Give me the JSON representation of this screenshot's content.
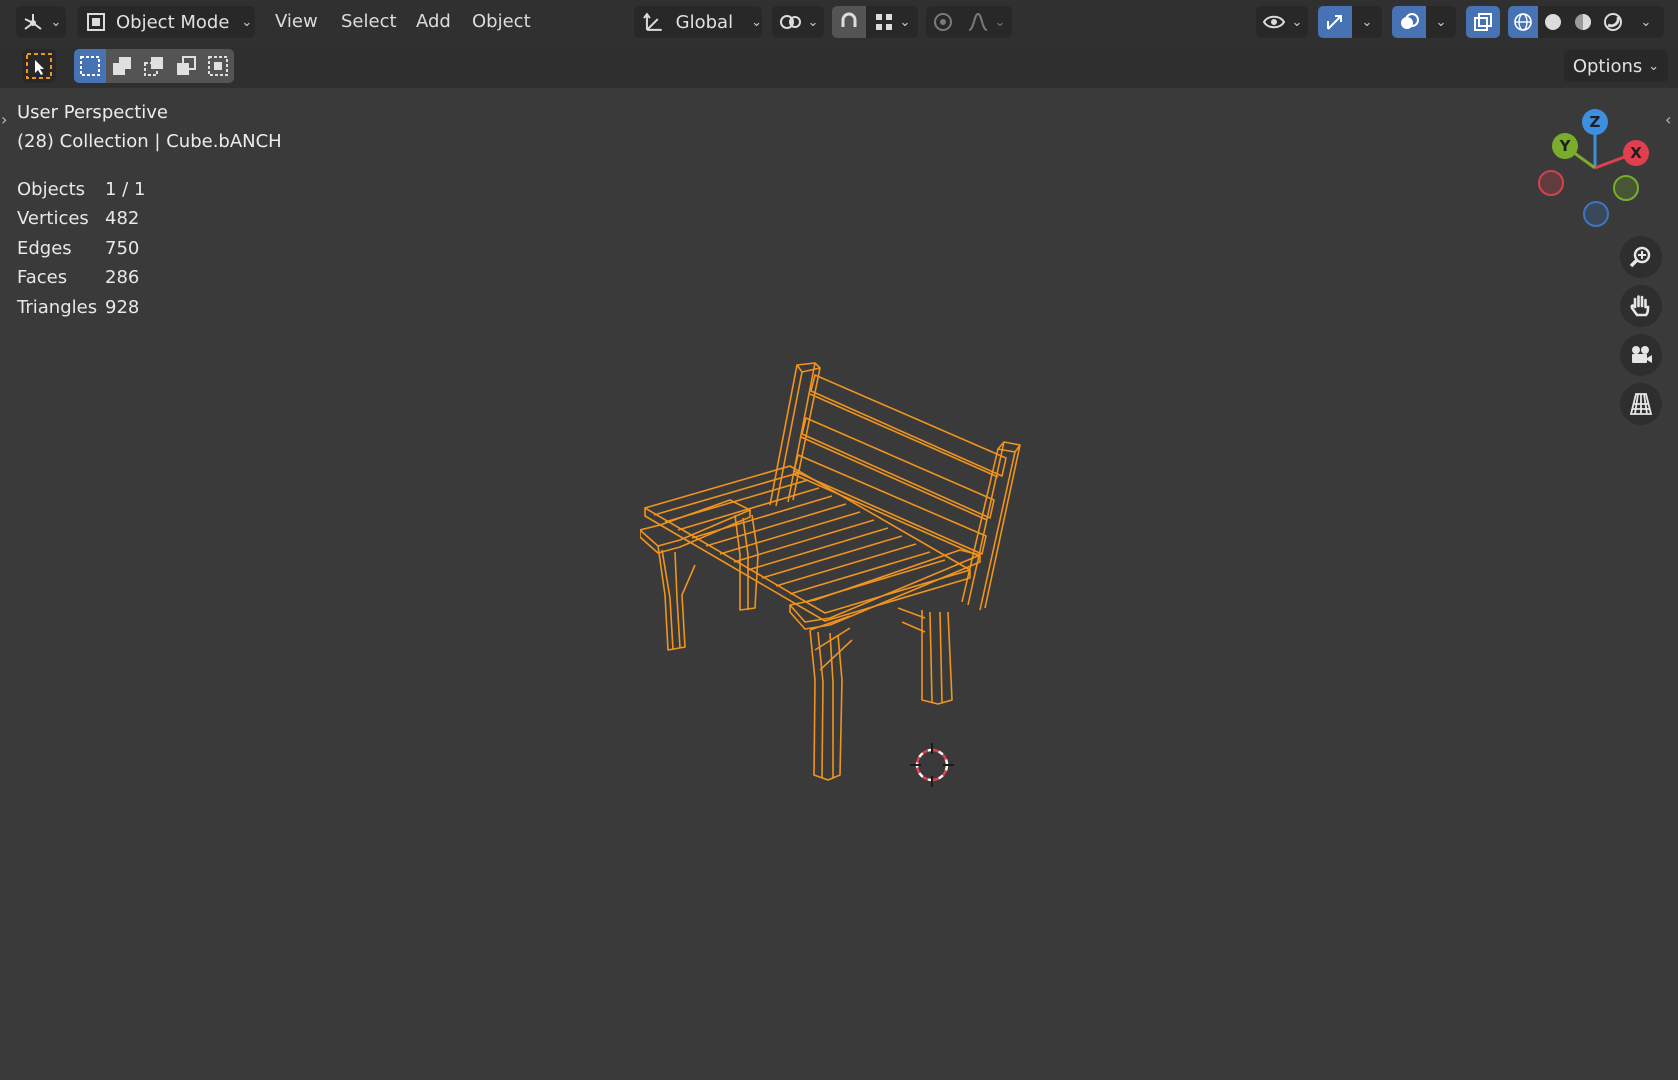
{
  "header": {
    "mode_selector": "Object Mode",
    "menus": [
      "View",
      "Select",
      "Add",
      "Object"
    ],
    "transform_orientation": "Global",
    "options_label": "Options"
  },
  "viewport": {
    "view_name": "User Perspective",
    "collection_line": "(28) Collection | Cube.bANCH",
    "stats": [
      {
        "label": "Objects",
        "value": "1 / 1"
      },
      {
        "label": "Vertices",
        "value": "482"
      },
      {
        "label": "Edges",
        "value": "750"
      },
      {
        "label": "Faces",
        "value": "286"
      },
      {
        "label": "Triangles",
        "value": "928"
      }
    ],
    "gizmo": {
      "x": "X",
      "y": "Y",
      "z": "Z"
    },
    "selected_object_color": "#f0941e"
  },
  "colors": {
    "axis_x": "#e0404e",
    "axis_y": "#79ad2c",
    "axis_z": "#3d8fe0",
    "accent": "#4772b3"
  }
}
